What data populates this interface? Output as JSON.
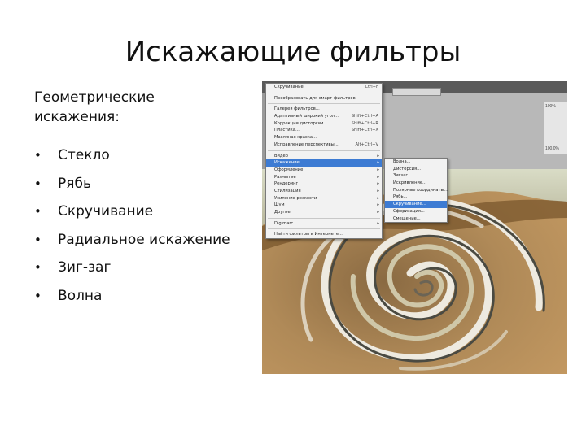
{
  "slide": {
    "title": "Искажающие фильтры",
    "subheading_line1": "Геометрические",
    "subheading_line2": "искажения:",
    "bullet_char": "•",
    "bullets": [
      "Стекло",
      "Рябь",
      "Скручивание",
      "Радиальное искажение",
      "Зиг-заг",
      "Волна"
    ]
  },
  "photoshop": {
    "panel_label_top": "100%",
    "panel_label_bottom": "100.0%",
    "filter_menu": [
      {
        "label": "Скручивание",
        "shortcut": "Ctrl+F"
      },
      {
        "sep": true
      },
      {
        "label": "Преобразовать для смарт-фильтров"
      },
      {
        "sep": true
      },
      {
        "label": "Галерея фильтров..."
      },
      {
        "label": "Адаптивный широкий угол...",
        "shortcut": "Shift+Ctrl+A"
      },
      {
        "label": "Коррекция дисторсии...",
        "shortcut": "Shift+Ctrl+R"
      },
      {
        "label": "Пластика...",
        "shortcut": "Shift+Ctrl+X"
      },
      {
        "label": "Масляная краска..."
      },
      {
        "label": "Исправление перспективы...",
        "shortcut": "Alt+Ctrl+V"
      },
      {
        "sep": true
      },
      {
        "label": "Видео",
        "sub": true
      },
      {
        "label": "Искажение",
        "sub": true,
        "hl": true
      },
      {
        "label": "Оформление",
        "sub": true
      },
      {
        "label": "Размытие",
        "sub": true
      },
      {
        "label": "Рендеринг",
        "sub": true
      },
      {
        "label": "Стилизация",
        "sub": true
      },
      {
        "label": "Усиление резкости",
        "sub": true
      },
      {
        "label": "Шум",
        "sub": true
      },
      {
        "label": "Другие",
        "sub": true
      },
      {
        "sep": true
      },
      {
        "label": "Digimarc",
        "sub": true
      },
      {
        "sep": true
      },
      {
        "label": "Найти фильтры в Интернете..."
      }
    ],
    "distort_submenu": [
      {
        "label": "Волна..."
      },
      {
        "label": "Дисторсия..."
      },
      {
        "label": "Зигзаг..."
      },
      {
        "label": "Искривление..."
      },
      {
        "label": "Полярные координаты..."
      },
      {
        "label": "Рябь..."
      },
      {
        "label": "Скручивание...",
        "hl": true
      },
      {
        "label": "Сферизация..."
      },
      {
        "label": "Смещение..."
      }
    ]
  }
}
